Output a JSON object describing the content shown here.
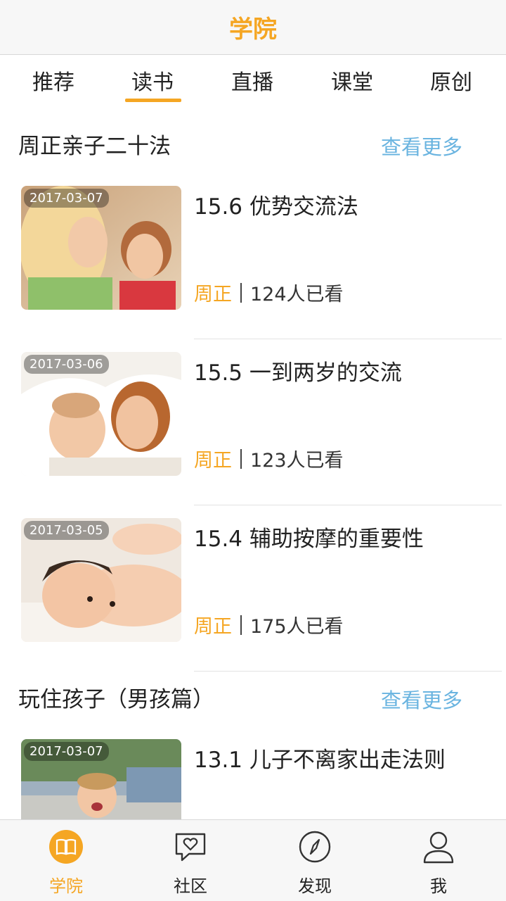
{
  "navbar": {
    "title": "学院"
  },
  "tabs": [
    {
      "label": "推荐"
    },
    {
      "label": "读书"
    },
    {
      "label": "直播"
    },
    {
      "label": "课堂"
    },
    {
      "label": "原创"
    }
  ],
  "active_tab": "读书",
  "sections": [
    {
      "title": "周正亲子二十法",
      "more_label": "查看更多",
      "items": [
        {
          "date": "2017-03-07",
          "title": "15.6 优势交流法",
          "author": "周正",
          "views": "124人已看"
        },
        {
          "date": "2017-03-06",
          "title": "15.5 一到两岁的交流",
          "author": "周正",
          "views": "123人已看"
        },
        {
          "date": "2017-03-05",
          "title": "15.4 辅助按摩的重要性",
          "author": "周正",
          "views": "175人已看"
        }
      ]
    },
    {
      "title": "玩住孩子（男孩篇）",
      "more_label": "查看更多",
      "items": [
        {
          "date": "2017-03-07",
          "title": "13.1 儿子不离家出走法则"
        }
      ]
    }
  ],
  "bottom_nav": [
    {
      "label": "学院",
      "icon": "book-icon"
    },
    {
      "label": "社区",
      "icon": "chat-heart-icon"
    },
    {
      "label": "发现",
      "icon": "compass-icon"
    },
    {
      "label": "我",
      "icon": "person-icon"
    }
  ],
  "colors": {
    "accent": "#f5a623",
    "link": "#6ab4e0"
  }
}
